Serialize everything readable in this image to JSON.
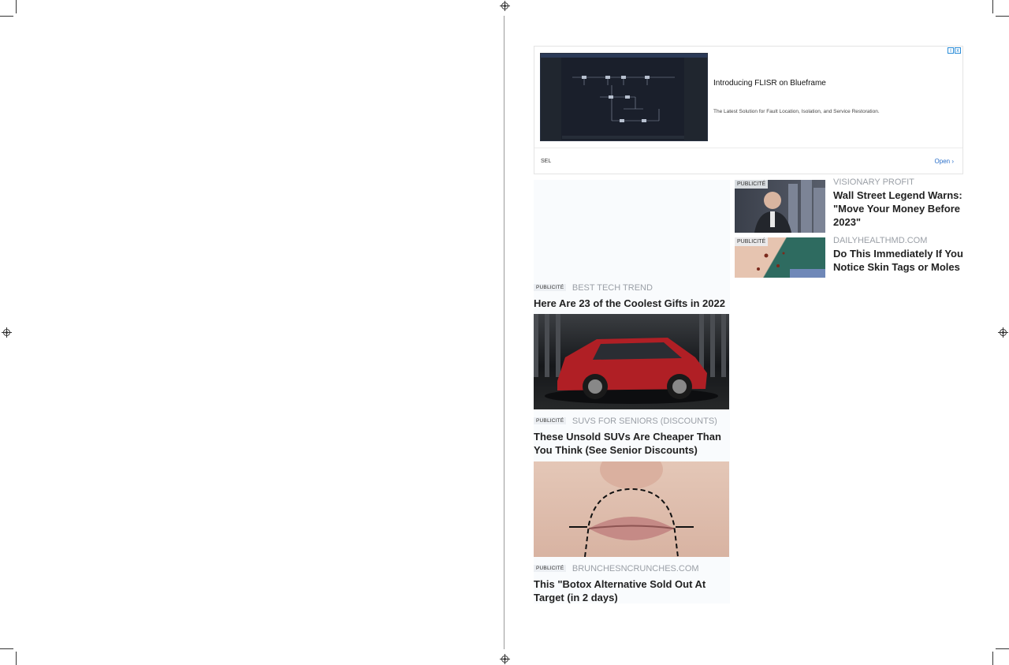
{
  "ad_banner": {
    "title": "Introducing FLISR on Blueframe",
    "description": "The Latest Solution for Fault Location, Isolation, and Service Restoration.",
    "sponsor": "SEL",
    "open_label": "Open",
    "open_icon": "chevron-right-icon",
    "adchoices": [
      "i",
      "x"
    ]
  },
  "cards": [
    {
      "badge": "PUBLICITÉ",
      "source": "BEST TECH TREND",
      "headline": "Here Are 23 of the Coolest Gifts in 2022"
    },
    {
      "badge": "PUBLICITÉ",
      "source": "SUVS FOR SENIORS (DISCOUNTS)",
      "headline": "These Unsold SUVs Are Cheaper Than You Think (See Senior Discounts)"
    },
    {
      "badge": "PUBLICITÉ",
      "source": "BRUNCHESNCRUNCHES.COM",
      "headline": "This \"Botox Alternative Sold Out At Target (in 2 days)"
    },
    {
      "badge": "PUBLICITÉ",
      "source": "VISIONARY PROFIT",
      "headline": "Wall Street Legend Warns: \"Move Your Money Before 2023\""
    },
    {
      "badge": "PUBLICITÉ",
      "source": "DAILYHEALTHMD.COM",
      "headline": "Do This Immediately If You Notice Skin Tags or Moles"
    }
  ]
}
